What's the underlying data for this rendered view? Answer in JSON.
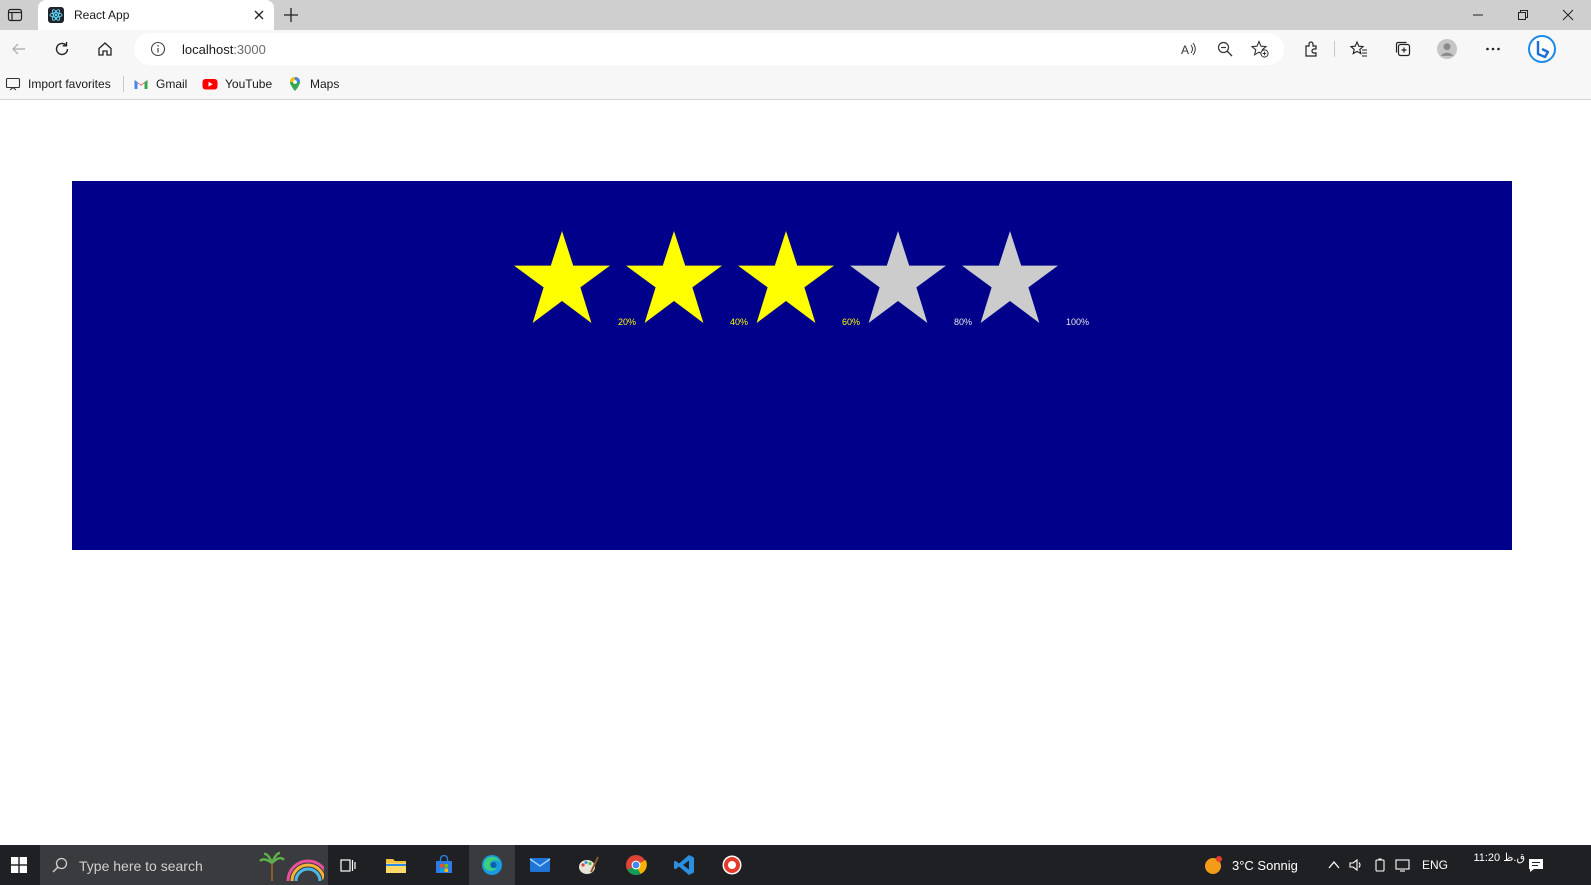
{
  "browser": {
    "tab": {
      "title": "React App"
    },
    "address": {
      "host": "localhost",
      "port": ":3000"
    },
    "favorites": [
      {
        "label": "Import favorites",
        "icon": "import-favorites-icon"
      },
      {
        "label": "Gmail",
        "icon": "gmail-icon"
      },
      {
        "label": "YouTube",
        "icon": "youtube-icon"
      },
      {
        "label": "Maps",
        "icon": "maps-icon"
      }
    ]
  },
  "rating": {
    "panel_color": "#00008b",
    "filled_color": "#ffff00",
    "empty_color": "#cccccc",
    "value": 3,
    "max": 5,
    "labels": [
      "20%",
      "40%",
      "60%",
      "80%",
      "100%"
    ]
  },
  "taskbar": {
    "search_placeholder": "Type here to search",
    "weather": "3°C  Sonnig",
    "language": "ENG",
    "time": "11:20 ق.ظ"
  }
}
